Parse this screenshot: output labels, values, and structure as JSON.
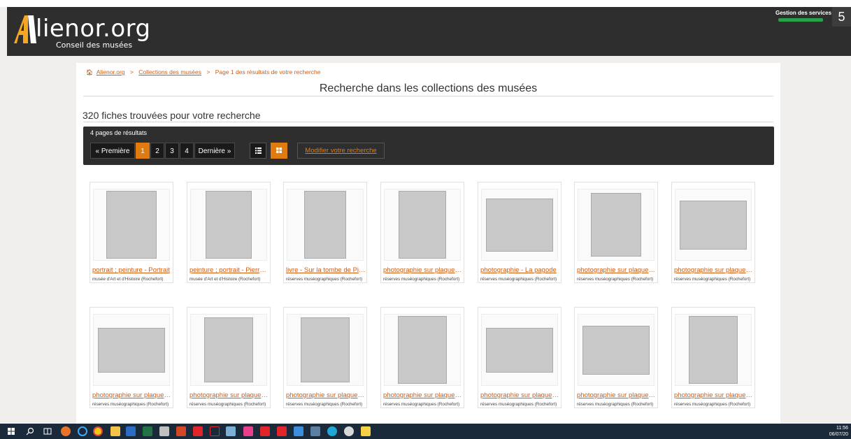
{
  "header": {
    "logo_text": "lienor.org",
    "logo_subtitle": "Conseil des musées",
    "services_label": "Gestion des services",
    "services_count": "5"
  },
  "breadcrumb": {
    "home": "Alienor.org",
    "collections": "Collections des musées",
    "current": "Page 1 des résultats de votre recherche"
  },
  "page_title": "Recherche dans les collections des musées",
  "results_count": "320 fiches trouvées pour votre recherche",
  "pager": {
    "pages_label": "4 pages de résultats",
    "first": "« Première",
    "pages": [
      "1",
      "2",
      "3",
      "4"
    ],
    "current_page": "1",
    "last": "Dernière »",
    "modify": "Modifier votre recherche"
  },
  "items": [
    {
      "title": "portrait ; peinture - Portrait",
      "sub": "musée d'Art et d'Histoire (Rochefort)"
    },
    {
      "title": "peinture ; portrait - Pierre Loti",
      "sub": "musée d'Art et d'Histoire (Rochefort)"
    },
    {
      "title": "livre - Sur la tombe de Pierre Loti",
      "sub": "réserves muséographiques (Rochefort)"
    },
    {
      "title": "photographie sur plaque de verre",
      "sub": "réserves muséographiques (Rochefort)"
    },
    {
      "title": "photographie - La pagode",
      "sub": "réserves muséographiques (Rochefort)"
    },
    {
      "title": "photographie sur plaque de verre",
      "sub": "réserves muséographiques (Rochefort)"
    },
    {
      "title": "photographie sur plaque de verre",
      "sub": "réserves muséographiques (Rochefort)"
    },
    {
      "title": "photographie sur plaque de verre",
      "sub": "réserves muséographiques (Rochefort)"
    },
    {
      "title": "photographie sur plaque de verre",
      "sub": "réserves muséographiques (Rochefort)"
    },
    {
      "title": "photographie sur plaque de verre",
      "sub": "réserves muséographiques (Rochefort)"
    },
    {
      "title": "photographie sur plaque de verre",
      "sub": "réserves muséographiques (Rochefort)"
    },
    {
      "title": "photographie sur plaque de verre",
      "sub": "réserves muséographiques (Rochefort)"
    },
    {
      "title": "photographie sur plaque de verre",
      "sub": "réserves muséographiques (Rochefort)"
    },
    {
      "title": "photographie sur plaque de verre",
      "sub": "réserves muséographiques (Rochefort)"
    }
  ],
  "taskbar": {
    "time": "11:56",
    "date": "06/07/20"
  },
  "colors": {
    "accent": "#e07b10",
    "link": "#d05c12",
    "header_bg": "#2e2e2e",
    "services_bar": "#2aa04a"
  }
}
